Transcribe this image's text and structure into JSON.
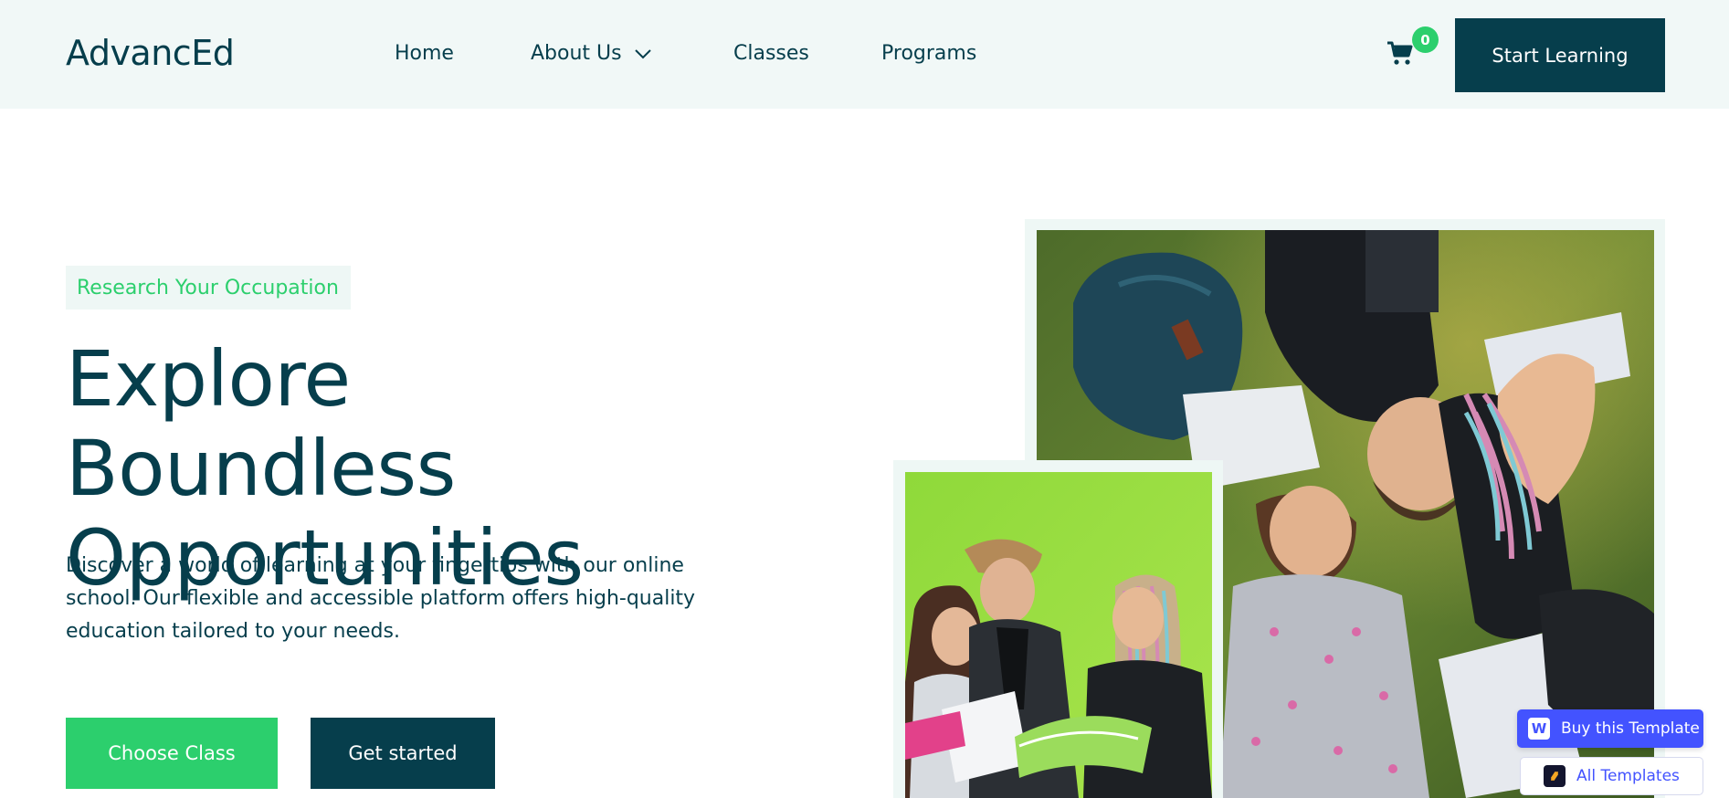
{
  "brand": {
    "logo": "AdvancEd"
  },
  "nav": {
    "home": "Home",
    "about": "About Us",
    "classes": "Classes",
    "programs": "Programs"
  },
  "header": {
    "cart_count": "0",
    "cta": "Start Learning"
  },
  "hero": {
    "tag": "Research Your Occupation",
    "title_line1": "Explore Boundless",
    "title_line2": "Opportunities",
    "description": "Discover a world of learning at your fingertips with our online school. Our flexible and accessible platform offers high-quality education tailored to your needs.",
    "primary_button": "Choose Class",
    "secondary_button": "Get started"
  },
  "floating": {
    "buy": "Buy this Template",
    "all": "All Templates"
  },
  "colors": {
    "primary": "#063e4c",
    "accent": "#2ccf6d",
    "header_bg": "#f1f8f7",
    "webflow": "#4353ff"
  },
  "icons": {
    "cart": "shopping-cart-icon",
    "chevron": "chevron-down-icon",
    "webflow": "webflow-logo-icon",
    "templates": "templates-logo-icon"
  }
}
